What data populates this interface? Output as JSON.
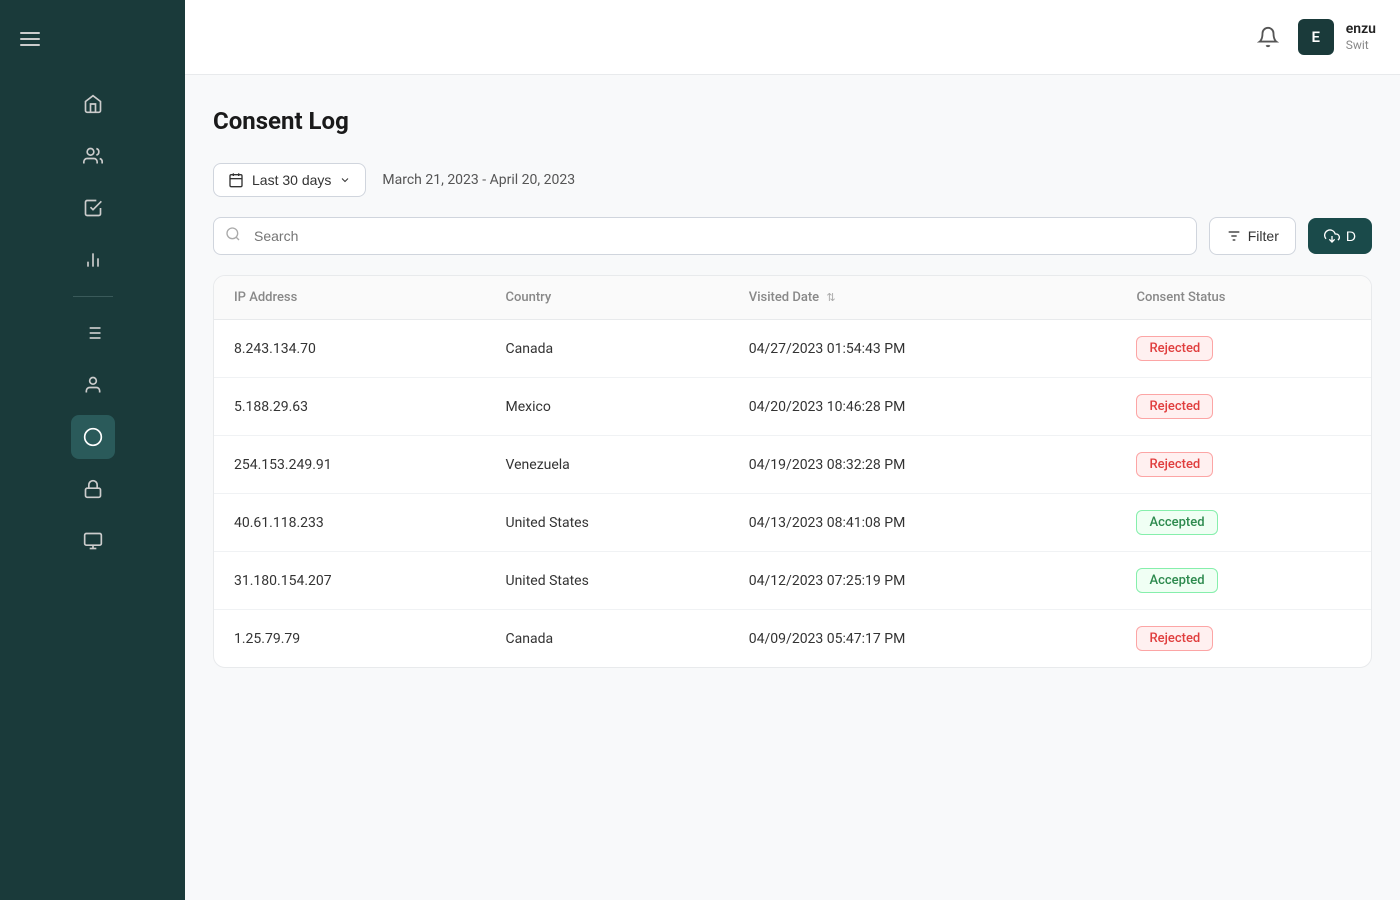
{
  "sidebar": {
    "icons": [
      {
        "name": "home-icon",
        "symbol": "🏠"
      },
      {
        "name": "users-icon",
        "symbol": "👥"
      },
      {
        "name": "tasks-icon",
        "symbol": "✔"
      },
      {
        "name": "chart-icon",
        "symbol": "📊"
      }
    ],
    "divider": true,
    "bottom_icons": [
      {
        "name": "list-icon",
        "symbol": "📋"
      },
      {
        "name": "profile-icon",
        "symbol": "👤"
      },
      {
        "name": "cookie-icon",
        "symbol": "🍪",
        "active": true
      },
      {
        "name": "lock-icon",
        "symbol": "🔒"
      },
      {
        "name": "terminal-icon",
        "symbol": "⌨"
      }
    ]
  },
  "header": {
    "user_initial": "E",
    "user_name": "enzu",
    "user_sub": "Swit"
  },
  "page": {
    "title": "Consent Log"
  },
  "filters": {
    "date_range_label": "Last 30 days",
    "date_range_text": "March 21, 2023 - April 20, 2023",
    "search_placeholder": "Search",
    "filter_label": "Filter",
    "download_label": "D"
  },
  "table": {
    "columns": [
      {
        "key": "ip",
        "label": "IP Address",
        "sortable": false
      },
      {
        "key": "country",
        "label": "Country",
        "sortable": false
      },
      {
        "key": "visited_date",
        "label": "Visited Date",
        "sortable": true
      },
      {
        "key": "consent_status",
        "label": "Consent Status",
        "sortable": false
      }
    ],
    "rows": [
      {
        "ip": "8.243.134.70",
        "country": "Canada",
        "visited_date": "04/27/2023 01:54:43 PM",
        "consent_status": "Rejected",
        "status_type": "rejected"
      },
      {
        "ip": "5.188.29.63",
        "country": "Mexico",
        "visited_date": "04/20/2023 10:46:28 PM",
        "consent_status": "Rejected",
        "status_type": "rejected"
      },
      {
        "ip": "254.153.249.91",
        "country": "Venezuela",
        "visited_date": "04/19/2023 08:32:28 PM",
        "consent_status": "Rejected",
        "status_type": "rejected"
      },
      {
        "ip": "40.61.118.233",
        "country": "United States",
        "visited_date": "04/13/2023 08:41:08 PM",
        "consent_status": "Accepted",
        "status_type": "accepted"
      },
      {
        "ip": "31.180.154.207",
        "country": "United States",
        "visited_date": "04/12/2023 07:25:19 PM",
        "consent_status": "Accepted",
        "status_type": "accepted"
      },
      {
        "ip": "1.25.79.79",
        "country": "Canada",
        "visited_date": "04/09/2023 05:47:17 PM",
        "consent_status": "Rejected",
        "status_type": "rejected"
      }
    ]
  }
}
